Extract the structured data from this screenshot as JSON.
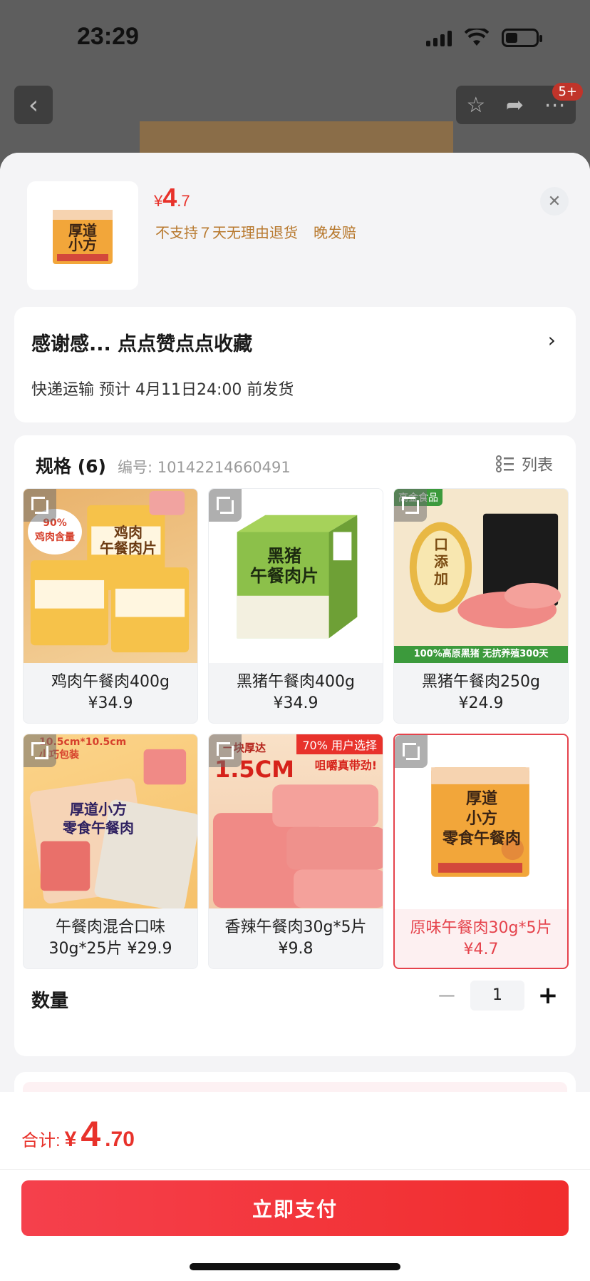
{
  "status_bar": {
    "time": "23:29"
  },
  "background": {
    "cart_badge": "5+"
  },
  "sheet": {
    "price": {
      "currency": "¥",
      "int": "4",
      "dec": ".7"
    },
    "notes": [
      "不支持７天无理由退货",
      "晚发赔"
    ],
    "close": "✕"
  },
  "info": {
    "title": "感谢感... 点点赞点点收藏",
    "shipping": "快递运输 预计 4月11日24:00 前发货"
  },
  "spec": {
    "title": "规格 (6)",
    "code": "编号: 10142214660491",
    "list_label": "列表",
    "options": [
      {
        "name": "鸡肉午餐肉400g",
        "price": "¥34.9",
        "art": "鸡肉\n午餐肉片",
        "tag": "90%\n鸡肉含量"
      },
      {
        "name": "黑猪午餐肉400g",
        "price": "¥34.9",
        "art": "黑猪\n午餐肉片",
        "tag": ""
      },
      {
        "name": "黑猪午餐肉250g",
        "price": "¥24.9",
        "art": "口\n添\n加",
        "tag": "100%高原黑猪 无抗养殖300天",
        "corner": "高金食品"
      },
      {
        "combo": "午餐肉混合口味\n30g*25片  ¥29.9",
        "art": "厚道小方\n零食午餐肉",
        "tag": "10.5cm*10.5cm\n小巧包装"
      },
      {
        "name": "香辣午餐肉30g*5片",
        "price": "¥9.8",
        "art": "1.5CM",
        "tag": "70% 用户选择",
        "sub": "一块厚达",
        "sub2": "咀嚼真带劲!"
      },
      {
        "name": "原味午餐肉30g*5片",
        "price": "¥4.7",
        "art": "厚道\n小方\n零食午餐肉",
        "tag": ""
      }
    ]
  },
  "quantity": {
    "label": "数量",
    "value": "1",
    "minus": "−",
    "plus": "+"
  },
  "footer": {
    "total_label": "合计:",
    "total_currency": "¥",
    "total_int": "4",
    "total_dec": ".70",
    "pay_label": "立即支付"
  },
  "colors": {
    "accent": "#e8322b",
    "note": "#b8792e",
    "selected_border": "#e5434c"
  }
}
